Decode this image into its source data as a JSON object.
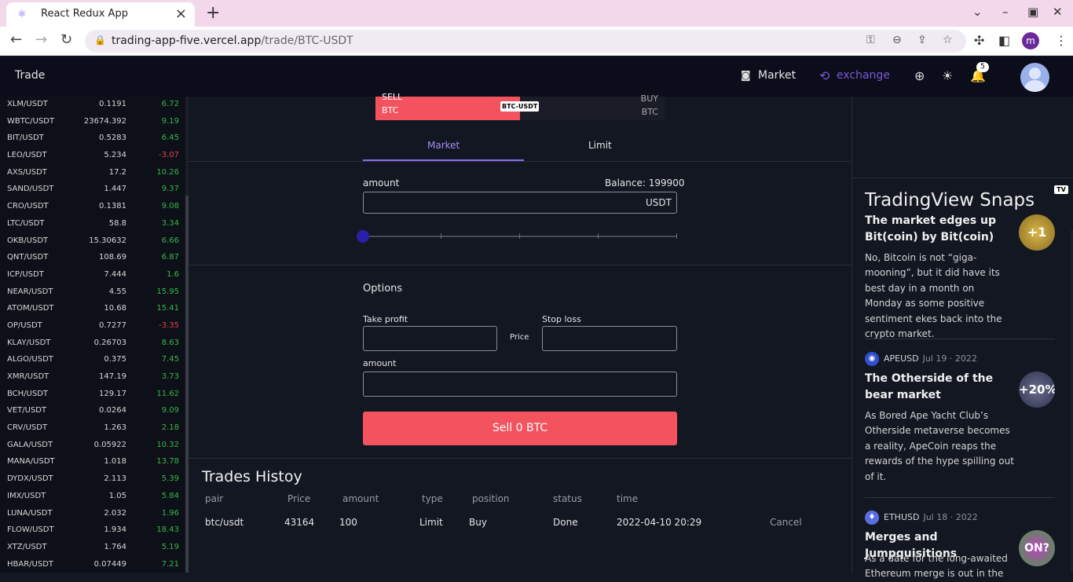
{
  "browser": {
    "tab_title": "React Redux App",
    "url_domain": "trading-app-five.vercel.app",
    "url_path": "/trade/BTC-USDT",
    "profile_initial": "m"
  },
  "header": {
    "brand": "Trade",
    "nav_market": "Market",
    "nav_exchange": "exchange",
    "notification_count": "5"
  },
  "markets": [
    {
      "pair": "XLM/USDT",
      "price": "0.1191",
      "change": "6.72",
      "neg": false
    },
    {
      "pair": "WBTC/USDT",
      "price": "23674.392",
      "change": "9.19",
      "neg": false
    },
    {
      "pair": "BIT/USDT",
      "price": "0.5283",
      "change": "6.45",
      "neg": false
    },
    {
      "pair": "LEO/USDT",
      "price": "5.234",
      "change": "-3.07",
      "neg": true
    },
    {
      "pair": "AXS/USDT",
      "price": "17.2",
      "change": "10.26",
      "neg": false
    },
    {
      "pair": "SAND/USDT",
      "price": "1.447",
      "change": "9.37",
      "neg": false
    },
    {
      "pair": "CRO/USDT",
      "price": "0.1381",
      "change": "9.08",
      "neg": false
    },
    {
      "pair": "LTC/USDT",
      "price": "58.8",
      "change": "3.34",
      "neg": false
    },
    {
      "pair": "OKB/USDT",
      "price": "15.30632",
      "change": "6.66",
      "neg": false
    },
    {
      "pair": "QNT/USDT",
      "price": "108.69",
      "change": "6.87",
      "neg": false
    },
    {
      "pair": "ICP/USDT",
      "price": "7.444",
      "change": "1.6",
      "neg": false
    },
    {
      "pair": "NEAR/USDT",
      "price": "4.55",
      "change": "15.95",
      "neg": false
    },
    {
      "pair": "ATOM/USDT",
      "price": "10.68",
      "change": "15.41",
      "neg": false
    },
    {
      "pair": "OP/USDT",
      "price": "0.7277",
      "change": "-3.35",
      "neg": true
    },
    {
      "pair": "KLAY/USDT",
      "price": "0.26703",
      "change": "8.63",
      "neg": false
    },
    {
      "pair": "ALGO/USDT",
      "price": "0.375",
      "change": "7.45",
      "neg": false
    },
    {
      "pair": "XMR/USDT",
      "price": "147.19",
      "change": "3.73",
      "neg": false
    },
    {
      "pair": "BCH/USDT",
      "price": "129.17",
      "change": "11.62",
      "neg": false
    },
    {
      "pair": "VET/USDT",
      "price": "0.0264",
      "change": "9.09",
      "neg": false
    },
    {
      "pair": "CRV/USDT",
      "price": "1.263",
      "change": "2.18",
      "neg": false
    },
    {
      "pair": "GALA/USDT",
      "price": "0.05922",
      "change": "10.32",
      "neg": false
    },
    {
      "pair": "MANA/USDT",
      "price": "1.018",
      "change": "13.78",
      "neg": false
    },
    {
      "pair": "DYDX/USDT",
      "price": "2.113",
      "change": "5.39",
      "neg": false
    },
    {
      "pair": "IMX/USDT",
      "price": "1.05",
      "change": "5.84",
      "neg": false
    },
    {
      "pair": "LUNA/USDT",
      "price": "2.032",
      "change": "1.96",
      "neg": false
    },
    {
      "pair": "FLOW/USDT",
      "price": "1.934",
      "change": "18.43",
      "neg": false
    },
    {
      "pair": "XTZ/USDT",
      "price": "1.764",
      "change": "5.19",
      "neg": false
    },
    {
      "pair": "HBAR/USDT",
      "price": "0.07449",
      "change": "7.21",
      "neg": false
    }
  ],
  "order": {
    "sell_label": "SELL",
    "sell_asset": "BTC",
    "buy_label": "BUY",
    "buy_asset": "BTC",
    "pair_tag": "BTC-USDT",
    "sell_ratio": 0.5,
    "tab_market": "Market",
    "tab_limit": "Limit",
    "amount_label": "amount",
    "balance": "Balance: 199900",
    "amount_unit": "USDT",
    "slider_value": 0,
    "options_title": "Options",
    "take_profit_label": "Take profit",
    "price_label": "Price",
    "stop_loss_label": "Stop loss",
    "amount2_label": "amount",
    "submit": "Sell 0 BTC"
  },
  "history": {
    "title": "Trades Histoy",
    "columns": [
      "pair",
      "Price",
      "amount",
      "type",
      "position",
      "status",
      "time"
    ],
    "rows": [
      {
        "pair": "btc/usdt",
        "price": "43164",
        "amount": "100",
        "type": "Limit",
        "position": "Buy",
        "status": "Done",
        "time": "2022-04-10 20:29",
        "action": "Cancel"
      }
    ]
  },
  "snaps": {
    "logo": "TV",
    "title": "TradingView Snaps",
    "items": [
      {
        "source": "",
        "date": "",
        "headline": "The market edges up Bit(coin) by Bit(coin)",
        "desc": "No, Bitcoin is not “giga-mooning”, but it did have its best day in a month on Monday as some positive sentiment ekes back into the crypto market.",
        "thumb": "+1"
      },
      {
        "source": "APEUSD",
        "date": "Jul 19 · 2022",
        "headline": "The Otherside of the bear market",
        "desc": "As Bored Ape Yacht Club’s Otherside metaverse becomes a reality, ApeCoin reaps the rewards of the hype spilling out of it.",
        "thumb": "+20%"
      },
      {
        "source": "ETHUSD",
        "date": "Jul 18 · 2022",
        "headline": "Merges and Jumpquisitions",
        "desc": "As a date for the long-awaited Ethereum merge is out in the",
        "thumb": "ON?"
      }
    ]
  }
}
